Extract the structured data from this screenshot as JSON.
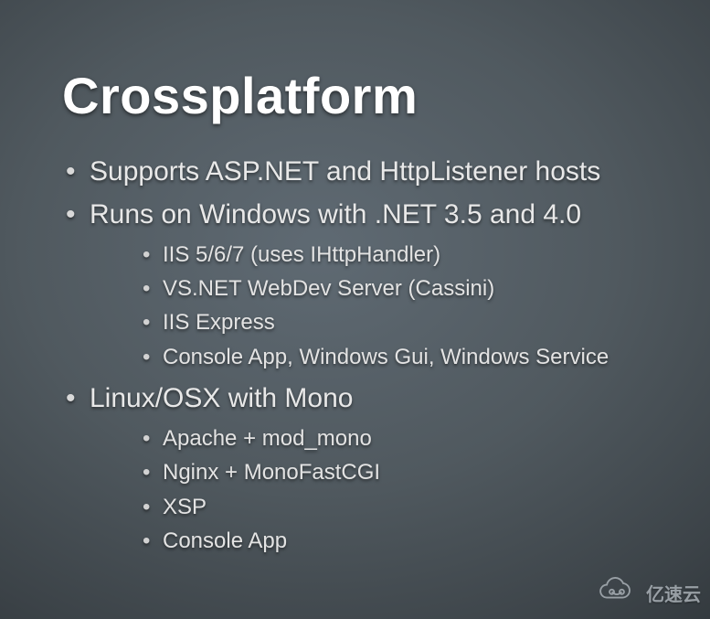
{
  "slide": {
    "title": "Crossplatform",
    "bullets": [
      {
        "text": "Supports ASP.NET and HttpListener hosts",
        "children": []
      },
      {
        "text": "Runs on Windows with .NET 3.5 and 4.0",
        "children": [
          "IIS 5/6/7 (uses IHttpHandler)",
          "VS.NET WebDev Server (Cassini)",
          "IIS Express",
          "Console App, Windows Gui, Windows Service"
        ]
      },
      {
        "text": "Linux/OSX with Mono",
        "children": [
          "Apache + mod_mono",
          "Nginx + MonoFastCGI",
          "XSP",
          "Console App"
        ]
      }
    ]
  },
  "watermark": {
    "text": "亿速云"
  }
}
